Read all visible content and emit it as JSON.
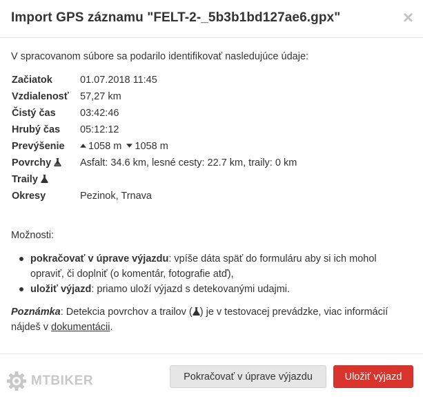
{
  "modal": {
    "title": "Import GPS záznamu \"FELT-2-_5b3b1bd127ae6.gpx\"",
    "close_symbol": "×"
  },
  "intro": "V spracovanom súbore sa podarilo identifikovať nasledujúce údaje:",
  "details": {
    "start": {
      "label": "Začiatok",
      "value": "01.07.2018 11:45"
    },
    "distance": {
      "label": "Vzdialenosť",
      "value": "57,27 km"
    },
    "net_time": {
      "label": "Čistý čas",
      "value": "03:42:46"
    },
    "gross_time": {
      "label": "Hrubý čas",
      "value": "05:12:12"
    },
    "elevation": {
      "label": "Prevýšenie",
      "up": "1058 m",
      "down": "1058 m",
      "up_icon": "caret-up-icon",
      "down_icon": "caret-down-icon"
    },
    "surfaces": {
      "label": "Povrchy",
      "value": "Asfalt: 34.6 km, lesné cesty: 22.7 km, traily: 0 km",
      "icon": "flask-icon"
    },
    "trails": {
      "label": "Traily",
      "value": "",
      "icon": "flask-icon"
    },
    "districts": {
      "label": "Okresy",
      "value": "Pezinok, Trnava"
    }
  },
  "options": {
    "label": "Možnosti:",
    "items": [
      {
        "title": "pokračovať v úprave výjazdu",
        "text": ": vpíše dáta späť do formuláru aby si ich mohol opraviť, či doplniť (o komentár, fotografie atď),"
      },
      {
        "title": "uložiť výjazd",
        "text": ": priamo uloží výjazd s detekovanými udajmi."
      }
    ]
  },
  "note": {
    "title": "Poznámka",
    "text_before": ": Detekcia povrchov a trailov (",
    "text_after": ") je v testovacej prevádzke, viac informácií nájdeš v ",
    "link": "dokumentácii",
    "end": "."
  },
  "footer": {
    "logo_text": "MTBIKER",
    "logo_icon": "gear-logo-icon",
    "continue_button": "Pokračovať v úprave výjazdu",
    "save_button": "Uložiť výjazd"
  },
  "colors": {
    "primary_button": "#d9342b",
    "secondary_button": "#e6e6e6",
    "logo": "#c8c8c8"
  }
}
